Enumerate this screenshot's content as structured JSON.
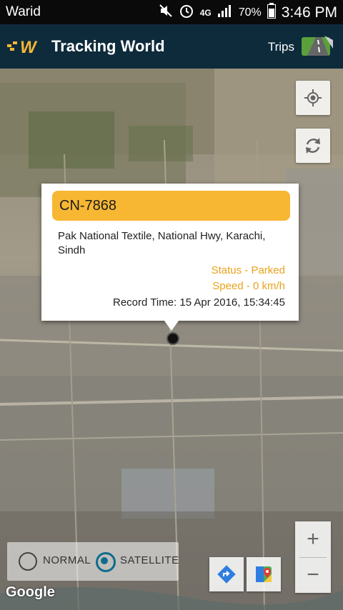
{
  "status_bar": {
    "carrier": "Warid",
    "network": "4G",
    "battery": "70%",
    "time": "3:46 PM",
    "icons": [
      "mute-icon",
      "alarm-icon",
      "4g-lte-icon",
      "signal-icon",
      "battery-icon"
    ]
  },
  "app_bar": {
    "title": "Tracking World",
    "trips_label": "Trips",
    "logo_icon": "tracking-world-logo",
    "trips_icon": "trips-road-icon",
    "color": "#0e2b3c"
  },
  "info_window": {
    "plate": "CN-7868",
    "address": "Pak National Textile,  National Hwy,  Karachi, Sindh",
    "status": "Status - Parked",
    "speed": "Speed - 0 km/h",
    "record_time": "Record Time: 15 Apr 2016, 15:34:45",
    "plate_color": "#f7b733",
    "status_color": "#e9a21c"
  },
  "map_controls": {
    "my_location_icon": "my-location-icon",
    "refresh_icon": "refresh-icon",
    "zoom_in": "+",
    "zoom_out": "−",
    "directions_icon": "directions-icon",
    "maps_icon": "google-maps-icon",
    "attribution": "Google"
  },
  "map_type": {
    "options": [
      {
        "label": "NORMAL",
        "selected": false
      },
      {
        "label": "SATELLITE",
        "selected": true
      }
    ],
    "accent": "#0d6c8c"
  }
}
